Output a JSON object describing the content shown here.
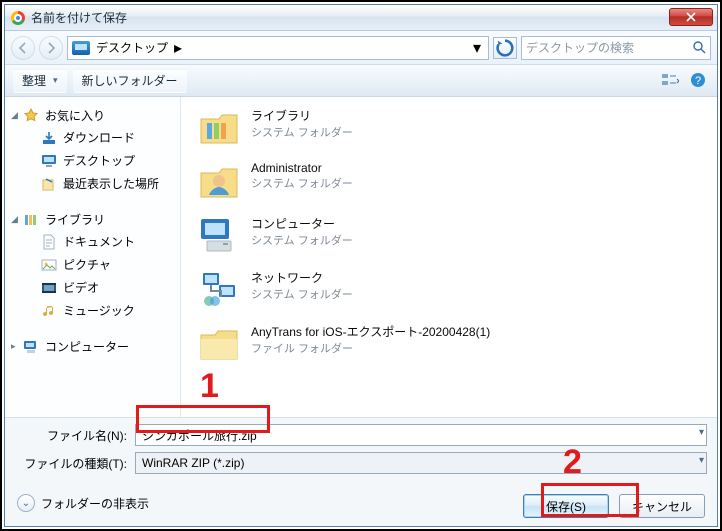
{
  "title": "名前を付けて保存",
  "breadcrumb": {
    "location": "デスクトップ"
  },
  "search": {
    "placeholder": "デスクトップの検索"
  },
  "toolbar": {
    "organize": "整理",
    "new_folder": "新しいフォルダー"
  },
  "sidebar": {
    "favorites": {
      "label": "お気に入り",
      "items": [
        "ダウンロード",
        "デスクトップ",
        "最近表示した場所"
      ]
    },
    "libraries": {
      "label": "ライブラリ",
      "items": [
        "ドキュメント",
        "ピクチャ",
        "ビデオ",
        "ミュージック"
      ]
    },
    "computer": {
      "label": "コンピューター"
    }
  },
  "content": {
    "items": [
      {
        "name": "ライブラリ",
        "sub": "システム フォルダー",
        "icon": "libraries"
      },
      {
        "name": "Administrator",
        "sub": "システム フォルダー",
        "icon": "user"
      },
      {
        "name": "コンピューター",
        "sub": "システム フォルダー",
        "icon": "computer"
      },
      {
        "name": "ネットワーク",
        "sub": "システム フォルダー",
        "icon": "network"
      },
      {
        "name": "AnyTrans for iOS-エクスポート-20200428(1)",
        "sub": "ファイル フォルダー",
        "icon": "folder"
      }
    ]
  },
  "filename": {
    "label": "ファイル名(N):",
    "value": "シンガポール旅行.zip"
  },
  "filetype": {
    "label": "ファイルの種類(T):",
    "value": "WinRAR ZIP           (*.zip)"
  },
  "hide_folders": "フォルダーの非表示",
  "buttons": {
    "save": "保存(S)",
    "cancel": "キャンセル"
  },
  "callouts": {
    "one": "1",
    "two": "2"
  }
}
